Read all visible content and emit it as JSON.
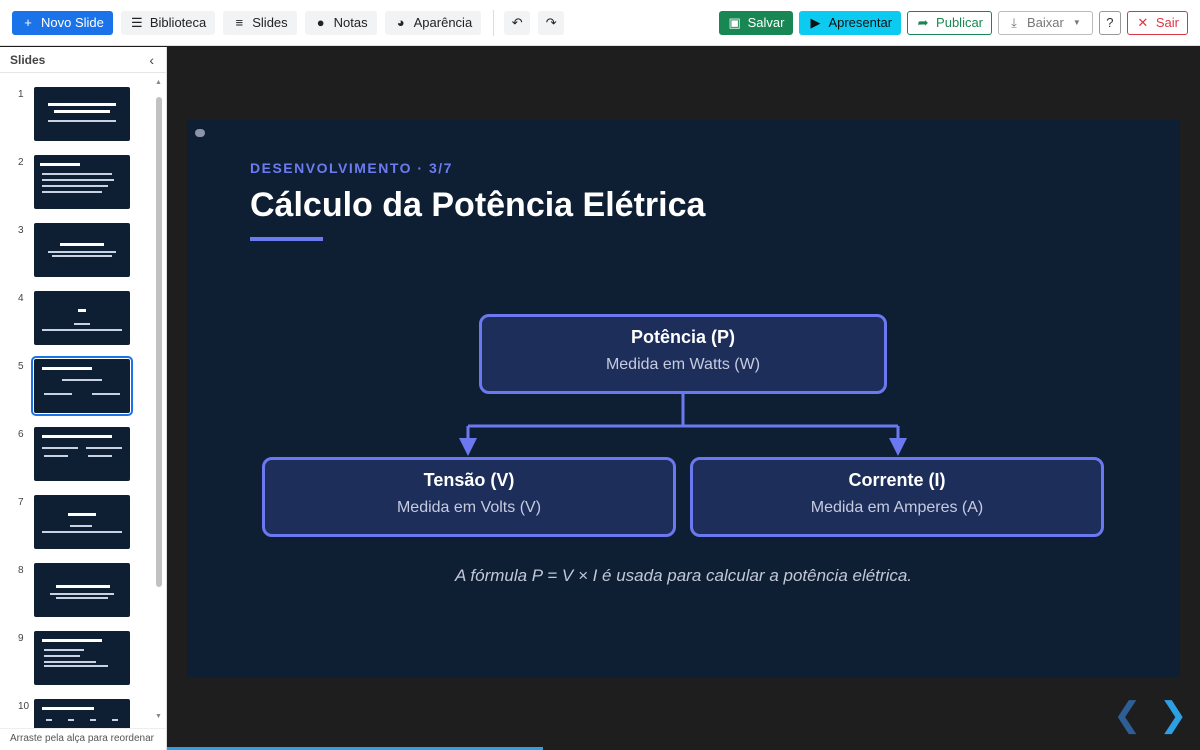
{
  "toolbar": {
    "new_slide": "Novo Slide",
    "library": "Biblioteca",
    "slides": "Slides",
    "notes": "Notas",
    "appearance": "Aparência",
    "save": "Salvar",
    "present": "Apresentar",
    "publish": "Publicar",
    "download": "Baixar",
    "help": "?",
    "exit": "Sair"
  },
  "sidebar": {
    "title": "Slides",
    "footer": "Arraste pela alça para reordenar",
    "items": [
      {
        "num": "1"
      },
      {
        "num": "2"
      },
      {
        "num": "3"
      },
      {
        "num": "4"
      },
      {
        "num": "5"
      },
      {
        "num": "6"
      },
      {
        "num": "7"
      },
      {
        "num": "8"
      },
      {
        "num": "9"
      },
      {
        "num": "10"
      }
    ],
    "active_index": 5
  },
  "slide": {
    "eyebrow": "DESENVOLVIMENTO · 3/7",
    "title": "Cálculo da Potência Elétrica",
    "top_box": {
      "title": "Potência (P)",
      "subtitle": "Medida em Watts (W)"
    },
    "left_box": {
      "title": "Tensão (V)",
      "subtitle": "Medida em Volts (V)"
    },
    "right_box": {
      "title": "Corrente (I)",
      "subtitle": "Medida em Amperes (A)"
    },
    "caption": "A fórmula P = V × I é usada para calcular a potência elétrica."
  },
  "colors": {
    "accent": "#6c7bf0",
    "slide_bg": "#0f1f33",
    "primary": "#1a73e8",
    "save": "#198754",
    "present": "#0dcaf0",
    "exit": "#dc3545"
  },
  "progress": 0.36
}
